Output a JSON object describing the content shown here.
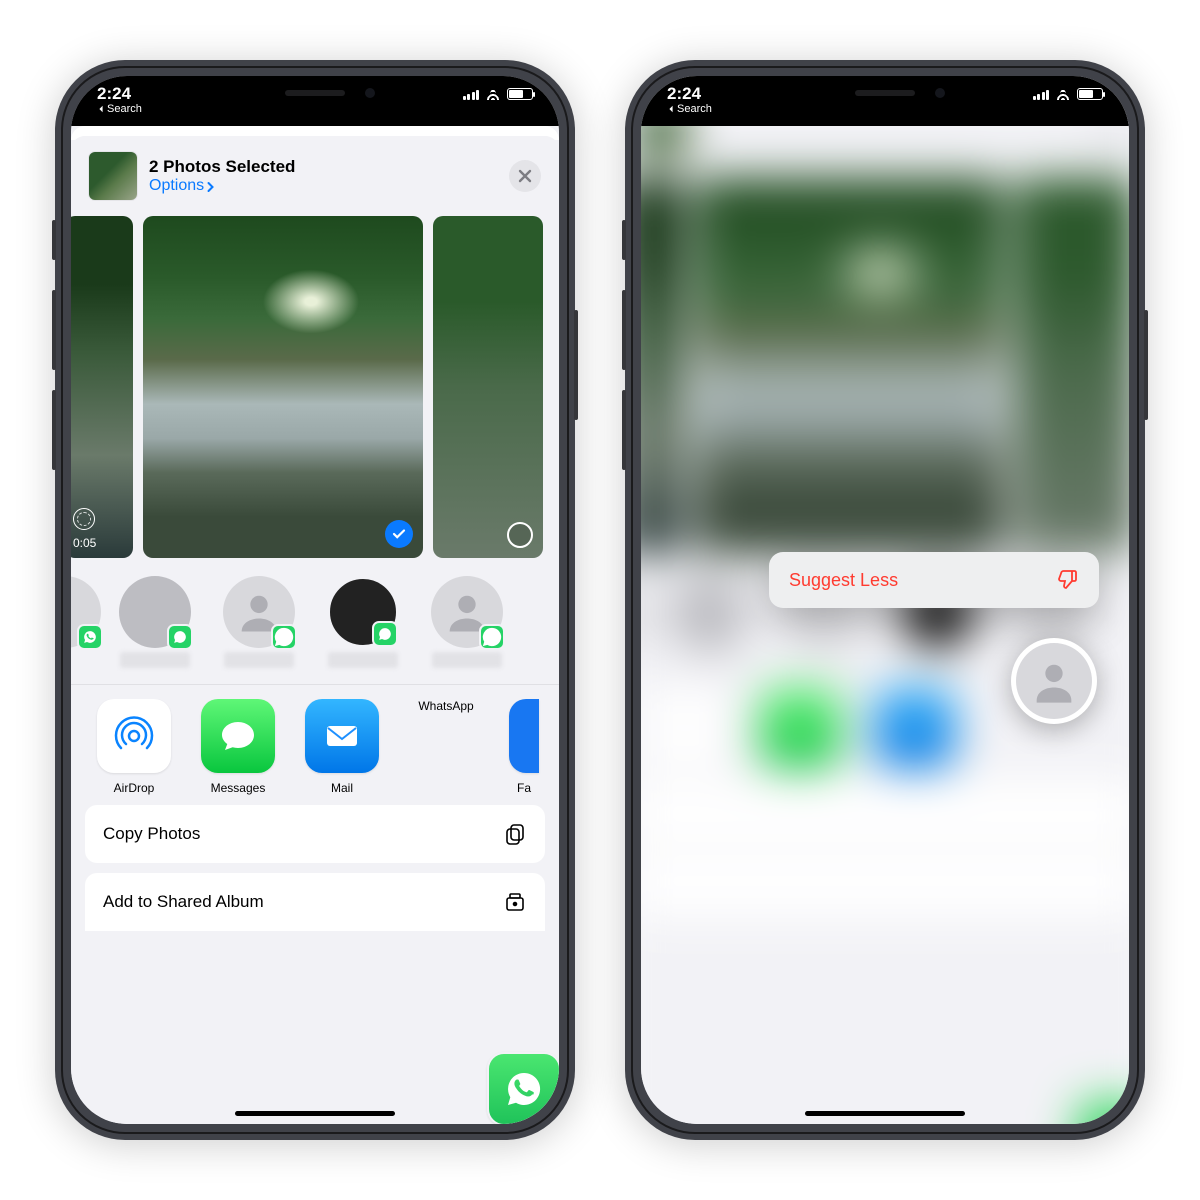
{
  "status": {
    "time": "2:24",
    "back_label": "Search"
  },
  "header": {
    "title": "2 Photos Selected",
    "options": "Options"
  },
  "strip": {
    "video_duration": "0:05"
  },
  "apps": {
    "airdrop": "AirDrop",
    "messages": "Messages",
    "mail": "Mail",
    "whatsapp": "WhatsApp",
    "facebook_partial": "Fa"
  },
  "actions": {
    "copy": "Copy Photos",
    "add_shared": "Add to Shared Album"
  },
  "popup": {
    "suggest_less": "Suggest Less"
  }
}
